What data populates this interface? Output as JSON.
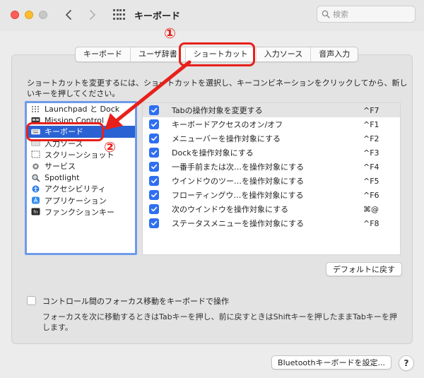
{
  "window": {
    "title": "キーボード",
    "search_placeholder": "検索"
  },
  "tabs": [
    {
      "label": "キーボード"
    },
    {
      "label": "ユーザ辞書"
    },
    {
      "label": "ショートカット",
      "selected": true
    },
    {
      "label": "入力ソース"
    },
    {
      "label": "音声入力"
    }
  ],
  "instruction": "ショートカットを変更するには、ショートカットを選択し、キーコンビネーションをクリックしてから、新しいキーを押してください。",
  "categories": [
    {
      "label": "Launchpad と Dock",
      "icon": "launchpad-icon"
    },
    {
      "label": "Mission Control",
      "icon": "mission-control-icon"
    },
    {
      "label": "キーボード",
      "icon": "keyboard-icon",
      "selected": true
    },
    {
      "label": "入力ソース",
      "icon": "input-sources-icon"
    },
    {
      "label": "スクリーンショット",
      "icon": "screenshot-icon"
    },
    {
      "label": "サービス",
      "icon": "services-gear-icon"
    },
    {
      "label": "Spotlight",
      "icon": "spotlight-icon"
    },
    {
      "label": "アクセシビリティ",
      "icon": "accessibility-icon"
    },
    {
      "label": "アプリケーション",
      "icon": "app-store-icon"
    },
    {
      "label": "ファンクションキー",
      "icon": "fn-key-icon"
    }
  ],
  "shortcuts": [
    {
      "label": "Tabの操作対象を変更する",
      "key": "^F7",
      "checked": true
    },
    {
      "label": "キーボードアクセスのオン/オフ",
      "key": "^F1",
      "checked": true
    },
    {
      "label": "メニューバーを操作対象にする",
      "key": "^F2",
      "checked": true
    },
    {
      "label": "Dockを操作対象にする",
      "key": "^F3",
      "checked": true
    },
    {
      "label": "一番手前または次…を操作対象にする",
      "key": "^F4",
      "checked": true
    },
    {
      "label": "ウインドウのツー…を操作対象にする",
      "key": "^F5",
      "checked": true
    },
    {
      "label": "フローティングウ…を操作対象にする",
      "key": "^F6",
      "checked": true
    },
    {
      "label": "次のウインドウを操作対象にする",
      "key": "⌘@",
      "checked": true
    },
    {
      "label": "ステータスメニューを操作対象にする",
      "key": "^F8",
      "checked": true
    }
  ],
  "buttons": {
    "restore_defaults": "デフォルトに戻す",
    "bluetooth_setup": "Bluetoothキーボードを設定...",
    "help": "?"
  },
  "keyboard_navigation": {
    "label": "コントロール間のフォーカス移動をキーボードで操作",
    "checked": false,
    "description": "フォーカスを次に移動するときはTabキーを押し、前に戻すときはShiftキーを押したままTabキーを押します。"
  },
  "annotations": {
    "step1": "①",
    "step2": "②",
    "color": "#e8201b"
  },
  "colors": {
    "selection": "#2a62d3",
    "checkbox": "#2e6ff1",
    "list_border": "#6d9bea"
  }
}
